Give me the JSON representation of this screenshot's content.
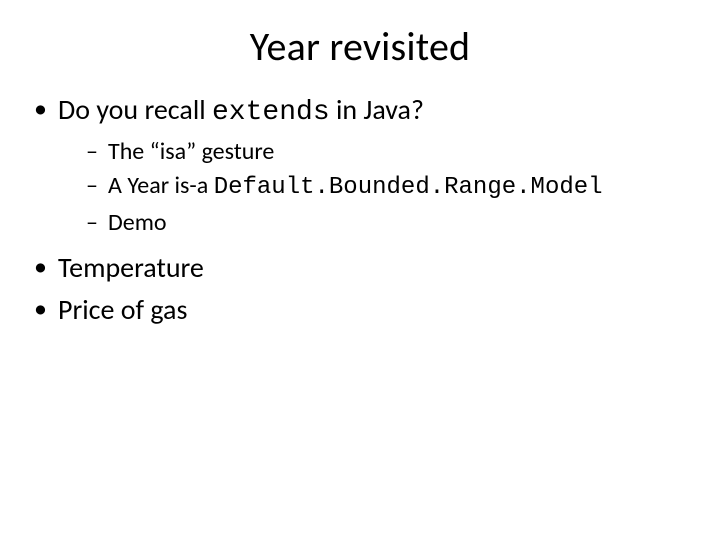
{
  "title": "Year revisited",
  "bullets": {
    "b1_pre": "Do you recall ",
    "b1_code": "extends",
    "b1_post": "  in Java?",
    "sub1": "The “isa” gesture",
    "sub2_pre": "A Year is-a ",
    "sub2_code": "Default.Bounded.Range.Model",
    "sub3": "Demo",
    "b2": "Temperature",
    "b3": "Price of gas"
  }
}
